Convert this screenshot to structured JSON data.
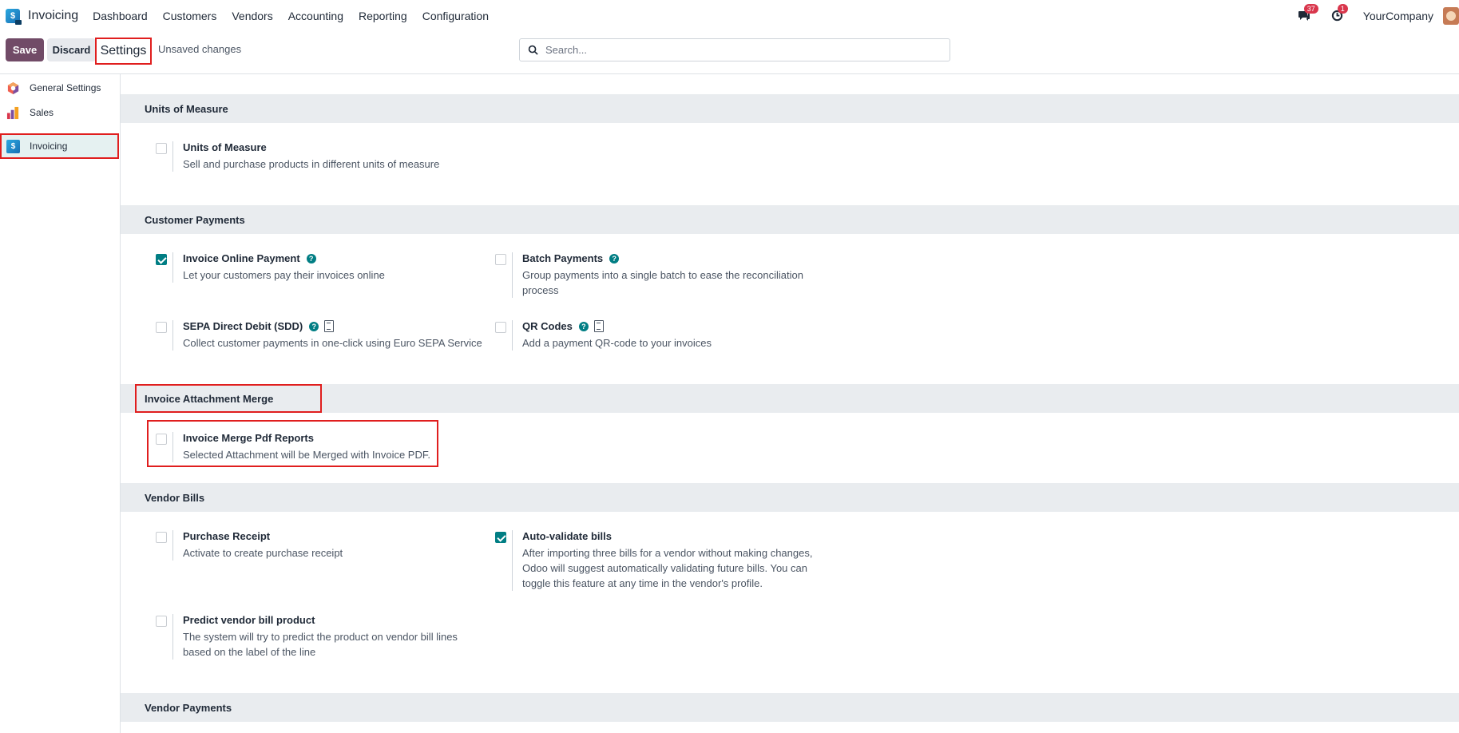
{
  "navbar": {
    "app_name": "Invoicing",
    "app_icon_letter": "$",
    "menu": [
      "Dashboard",
      "Customers",
      "Vendors",
      "Accounting",
      "Reporting",
      "Configuration"
    ],
    "messages_count": "37",
    "activities_count": "1",
    "company": "YourCompany"
  },
  "control": {
    "save_label": "Save",
    "discard_label": "Discard",
    "title": "Settings",
    "status": "Unsaved changes",
    "search_placeholder": "Search..."
  },
  "sidebar": {
    "items": [
      {
        "label": "General Settings",
        "icon": "odoo-icon"
      },
      {
        "label": "Sales",
        "icon": "sales-chart-icon"
      },
      {
        "label": "Invoicing",
        "icon": "invoicing-app-icon",
        "active": true
      }
    ]
  },
  "sections": {
    "uom": {
      "title": "Units of Measure",
      "uom_setting": {
        "title": "Units of Measure",
        "desc": "Sell and purchase products in different units of measure",
        "checked": false
      }
    },
    "customer_payments": {
      "title": "Customer Payments",
      "online_payment": {
        "title": "Invoice Online Payment",
        "desc": "Let your customers pay their invoices online",
        "checked": true
      },
      "batch_payments": {
        "title": "Batch Payments",
        "desc": "Group payments into a single batch to ease the reconciliation process",
        "checked": false
      },
      "sepa": {
        "title": "SEPA Direct Debit (SDD)",
        "desc": "Collect customer payments in one-click using Euro SEPA Service",
        "checked": false
      },
      "qr_codes": {
        "title": "QR Codes",
        "desc": "Add a payment QR-code to your invoices",
        "checked": false
      }
    },
    "attachment_merge": {
      "title": "Invoice Attachment Merge",
      "merge_pdf": {
        "title": "Invoice Merge Pdf Reports",
        "desc": "Selected Attachment will be Merged with Invoice PDF.",
        "checked": false
      }
    },
    "vendor_bills": {
      "title": "Vendor Bills",
      "purchase_receipt": {
        "title": "Purchase Receipt",
        "desc": "Activate to create purchase receipt",
        "checked": false
      },
      "auto_validate": {
        "title": "Auto-validate bills",
        "desc": "After importing three bills for a vendor without making changes, Odoo will suggest automatically validating future bills. You can toggle this feature at any time in the vendor's profile.",
        "checked": true
      },
      "predict_product": {
        "title": "Predict vendor bill product",
        "desc": "The system will try to predict the product on vendor bill lines based on the label of the line",
        "checked": false
      }
    },
    "vendor_payments": {
      "title": "Vendor Payments"
    }
  },
  "colors": {
    "primary": "#714b67",
    "accent": "#017e84",
    "highlight": "#e01e1e"
  }
}
